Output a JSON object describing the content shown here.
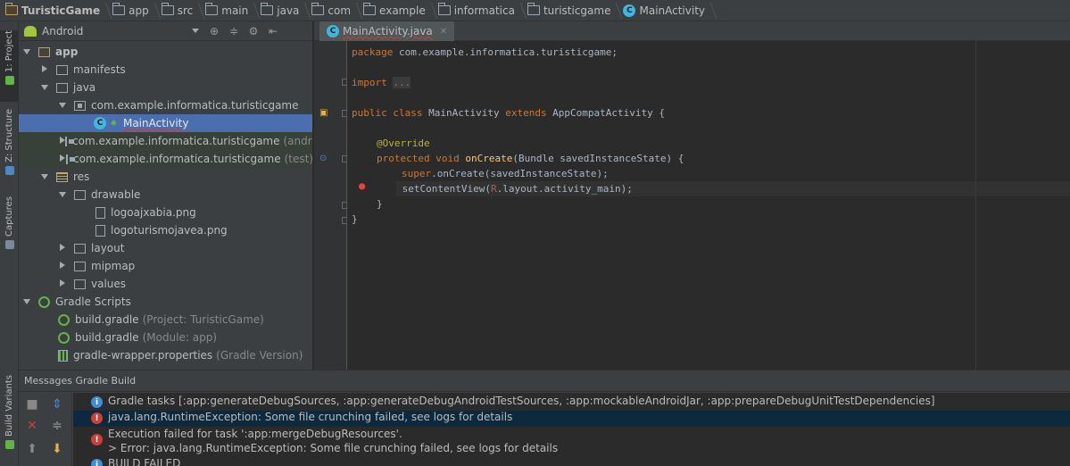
{
  "breadcrumb": [
    {
      "label": "TuristicGame",
      "icon": "project-folder-icon"
    },
    {
      "label": "app",
      "icon": "module-folder-icon"
    },
    {
      "label": "src",
      "icon": "folder-icon"
    },
    {
      "label": "main",
      "icon": "folder-icon"
    },
    {
      "label": "java",
      "icon": "folder-icon"
    },
    {
      "label": "com",
      "icon": "folder-icon"
    },
    {
      "label": "example",
      "icon": "folder-icon"
    },
    {
      "label": "informatica",
      "icon": "folder-icon"
    },
    {
      "label": "turisticgame",
      "icon": "folder-icon"
    },
    {
      "label": "MainActivity",
      "icon": "class-icon"
    }
  ],
  "left_strip": {
    "project_tab": "1: Project",
    "structure_tab": "Z: Structure",
    "captures_tab": "Captures",
    "build_variants_tab": "Build Variants"
  },
  "project_panel": {
    "view_mode": "Android",
    "tree": [
      {
        "label": "app",
        "icon": "module-folder-icon"
      },
      {
        "label": "manifests",
        "icon": "folder-icon"
      },
      {
        "label": "java",
        "icon": "folder-icon"
      },
      {
        "label": "com.example.informatica.turisticgame",
        "icon": "package-icon"
      },
      {
        "label": "MainActivity",
        "icon": "class-icon"
      },
      {
        "label": "com.example.informatica.turisticgame",
        "note": "(androidTest)",
        "icon": "package-icon"
      },
      {
        "label": "com.example.informatica.turisticgame",
        "note": "(test)",
        "icon": "package-icon"
      },
      {
        "label": "res",
        "icon": "resource-folder-icon"
      },
      {
        "label": "drawable",
        "icon": "folder-icon"
      },
      {
        "label": "logoajxabia.png",
        "icon": "image-file-icon"
      },
      {
        "label": "logoturismojavea.png",
        "icon": "image-file-icon"
      },
      {
        "label": "layout",
        "icon": "folder-icon"
      },
      {
        "label": "mipmap",
        "icon": "folder-icon"
      },
      {
        "label": "values",
        "icon": "folder-icon"
      },
      {
        "label": "Gradle Scripts",
        "icon": "gradle-icon"
      },
      {
        "label": "build.gradle",
        "note": "(Project: TuristicGame)",
        "icon": "gradle-icon"
      },
      {
        "label": "build.gradle",
        "note": "(Module: app)",
        "icon": "gradle-icon"
      },
      {
        "label": "gradle-wrapper.properties",
        "note": "(Gradle Version)",
        "icon": "properties-file-icon"
      }
    ]
  },
  "editor": {
    "tab_label": "MainActivity.java",
    "lines": {
      "l1_kw": "package",
      "l1_rest": " com.example.informatica.turisticgame;",
      "l2_kw": "import",
      "l2_fold": "...",
      "l3_kw1": "public class",
      "l3_name": " MainActivity ",
      "l3_kw2": "extends",
      "l3_rest": " AppCompatActivity {",
      "l4_ann": "@Override",
      "l5_kw": "protected void",
      "l5_fn": " onCreate",
      "l5_rest": "(Bundle savedInstanceState) {",
      "l6_kw": "super",
      "l6_rest": ".onCreate(savedInstanceState);",
      "l7_a": "setContentView(",
      "l7_r": "R",
      "l7_b": ".layout.activity_main);",
      "l8": "}",
      "l9": "}"
    }
  },
  "bottom_panel": {
    "title": "Messages Gradle Build",
    "messages": [
      {
        "type": "info",
        "text": "Gradle tasks [:app:generateDebugSources, :app:generateDebugAndroidTestSources, :app:mockableAndroidJar, :app:prepareDebugUnitTestDependencies]"
      },
      {
        "type": "error",
        "text": "java.lang.RuntimeException: Some file crunching failed, see logs for details"
      },
      {
        "type": "error",
        "text": "Execution failed for task ':app:mergeDebugResources'.",
        "detail": "> Error: java.lang.RuntimeException: Some file crunching failed, see logs for details"
      },
      {
        "type": "info",
        "text": "BUILD FAILED"
      }
    ]
  },
  "colors": {
    "background": "#2b2b2b",
    "panel": "#3c3f41",
    "selection": "#4b6eaf",
    "keyword": "#cc7832",
    "error": "#c9423a",
    "info": "#3a8fd6"
  }
}
